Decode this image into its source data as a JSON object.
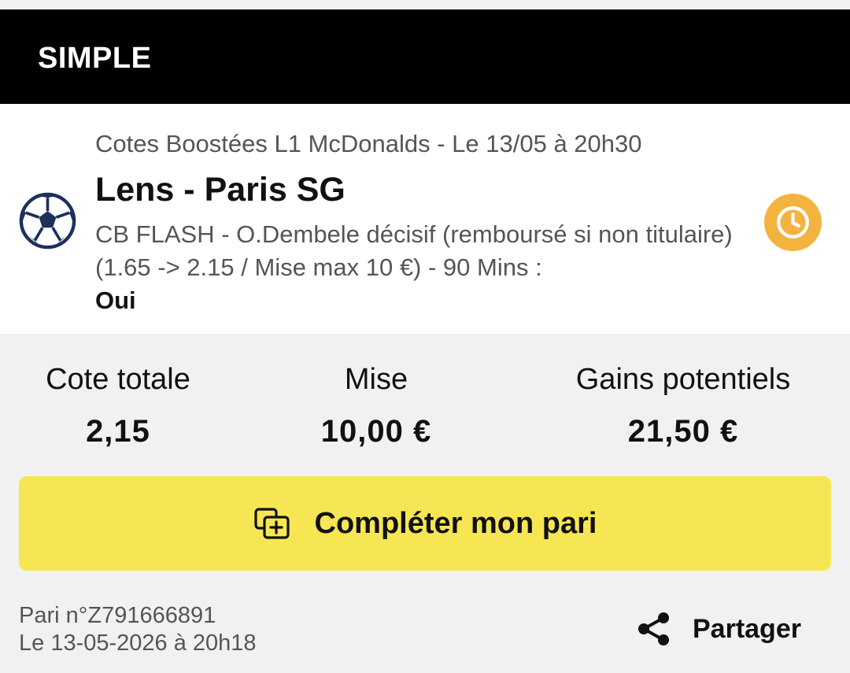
{
  "header": {
    "title": "SIMPLE"
  },
  "bet": {
    "icon": "football-icon",
    "competition": "Cotes Boostées L1 McDonalds - Le 13/05 à 20h30",
    "match": "Lens - Paris SG",
    "selection": "CB FLASH - O.Dembele décisif (remboursé si non titulaire) (1.65 -> 2.15 / Mise max 10 €) - 90 Mins :",
    "outcome": "Oui",
    "status_icon": "clock-icon"
  },
  "summary": {
    "total_odds_label": "Cote totale",
    "total_odds_value": "2,15",
    "stake_label": "Mise",
    "stake_value": "10,00 €",
    "potential_winnings_label": "Gains potentiels",
    "potential_winnings_value": "21,50 €"
  },
  "actions": {
    "complete_label": "Compléter mon pari",
    "complete_icon": "add-copy-icon",
    "share_label": "Partager",
    "share_icon": "share-icon"
  },
  "footer": {
    "bet_reference": "Pari n°Z791666891",
    "bet_date": "Le 13-05-2026 à 20h18"
  },
  "colors": {
    "header_bg": "#000000",
    "page_bg": "#f2f1f1",
    "card_bg": "#ffffff",
    "button_bg": "#f6e653",
    "clock_accent": "#f4b23e",
    "ball_color": "#1d2f5c"
  }
}
